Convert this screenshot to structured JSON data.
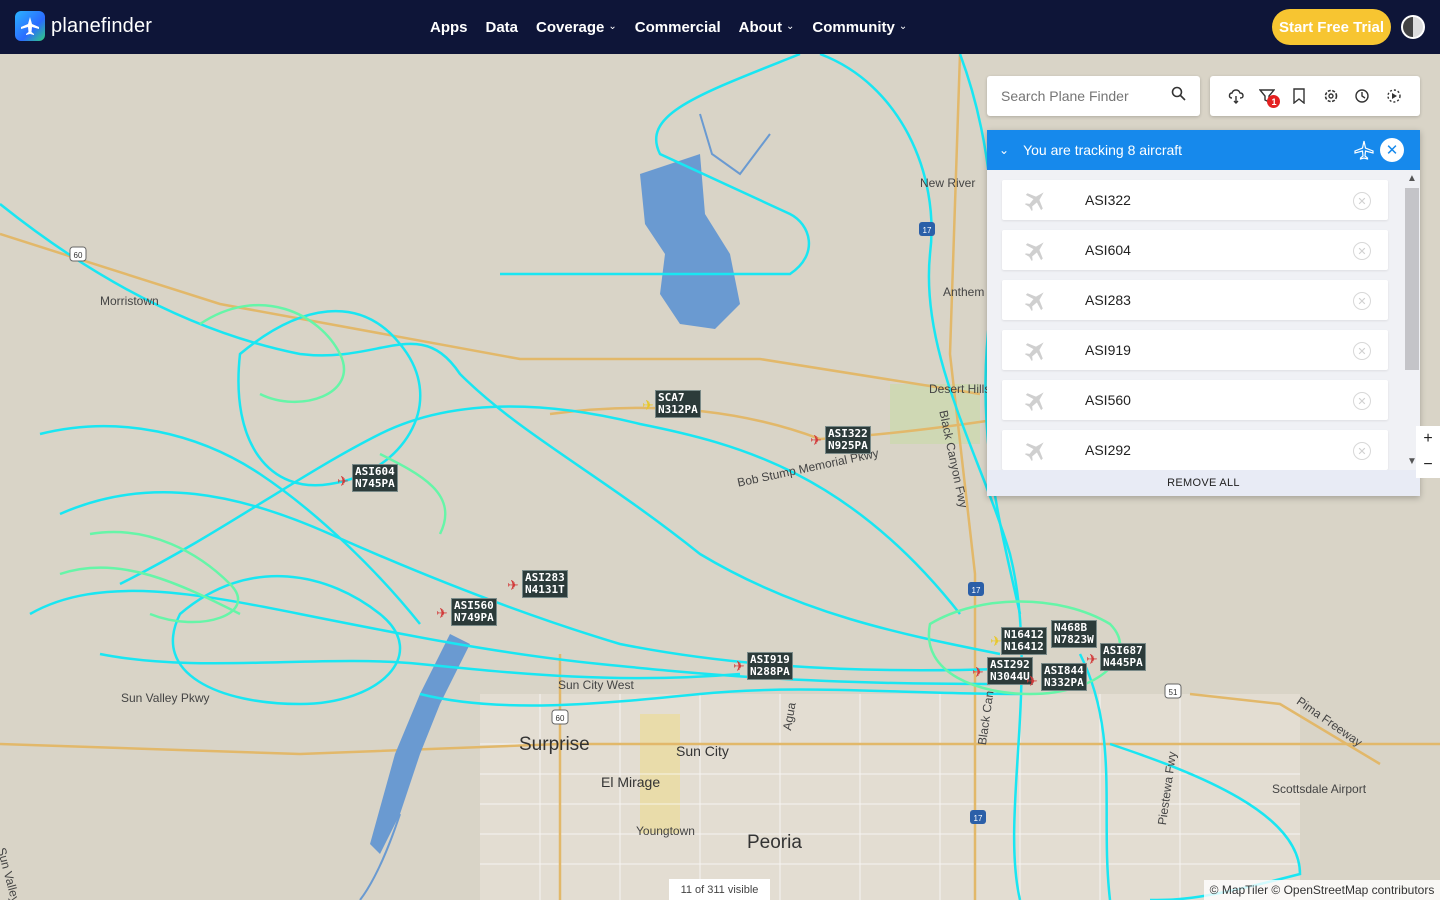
{
  "header": {
    "logo_text": "planefinder",
    "nav": [
      {
        "label": "Apps",
        "dropdown": false
      },
      {
        "label": "Data",
        "dropdown": false
      },
      {
        "label": "Coverage",
        "dropdown": true
      },
      {
        "label": "Commercial",
        "dropdown": false
      },
      {
        "label": "About",
        "dropdown": true
      },
      {
        "label": "Community",
        "dropdown": true
      }
    ],
    "cta_label": "Start Free Trial",
    "brand_color": "#0e1538",
    "cta_color": "#f7c531"
  },
  "search": {
    "placeholder": "Search Plane Finder"
  },
  "toolbar": {
    "icons": [
      "weather-icon",
      "filter-icon",
      "bookmark-icon",
      "settings-icon",
      "history-icon",
      "playback-icon"
    ],
    "filter_badge": "1"
  },
  "tracking": {
    "title": "You are tracking 8 aircraft",
    "items": [
      "ASI322",
      "ASI604",
      "ASI283",
      "ASI919",
      "ASI560",
      "ASI292"
    ],
    "remove_all": "REMOVE ALL",
    "accent": "#1689ec"
  },
  "map": {
    "places": {
      "new_river": "New River",
      "anthem": "Anthem",
      "desert_hills": "Desert Hills",
      "morristown": "Morristown",
      "surprise": "Surprise",
      "sun_city": "Sun City",
      "el_mirage": "El Mirage",
      "youngtown": "Youngtown",
      "peoria": "Peoria",
      "scottsdale_airport": "Scottsdale Airport",
      "sun_valley_pkwy": "Sun Valley Pkwy",
      "sun_valley_pkwy_2": "Sun Valley Pkwy",
      "bob_stump": "Bob Stump Memorial Pkwy",
      "black_canyon": "Black Canyon Fwy",
      "black_canyon_2": "Black Can",
      "pima_freeway": "Pima Freeway",
      "piestewa": "Piestewa Fwy",
      "agua": "Agua",
      "sun_west": "Sun City West"
    },
    "aircraft": [
      {
        "line1": "ASI604",
        "line2": "N745PA",
        "icon": "red"
      },
      {
        "line1": "SCA7",
        "line2": "N312PA",
        "icon": "yellow"
      },
      {
        "line1": "ASI322",
        "line2": "N925PA",
        "icon": "red"
      },
      {
        "line1": "ASI283",
        "line2": "N4131T",
        "icon": "red"
      },
      {
        "line1": "ASI560",
        "line2": "N749PA",
        "icon": "red"
      },
      {
        "line1": "ASI919",
        "line2": "N288PA",
        "icon": "red"
      },
      {
        "line1": "N468B",
        "line2": "N7823W",
        "icon": "red"
      },
      {
        "line1": "N16412",
        "line2": "N16412",
        "icon": "yellow"
      },
      {
        "line1": "ASI687",
        "line2": "N445PA",
        "icon": "red"
      },
      {
        "line1": "ASI292",
        "line2": "N3044U",
        "icon": "red"
      },
      {
        "line1": "ASI844",
        "line2": "N332PA",
        "icon": "red"
      }
    ],
    "route_shields": [
      "60",
      "17",
      "17",
      "17",
      "51",
      "60"
    ],
    "track_color": "#19e6f2",
    "track_alt_color": "#66f5a8",
    "water_color": "#6a9ad1"
  },
  "footer": {
    "visible_count": "11 of 311 visible",
    "attribution": "© MapTiler © OpenStreetMap contributors",
    "zoom_in": "+",
    "zoom_out": "−"
  }
}
